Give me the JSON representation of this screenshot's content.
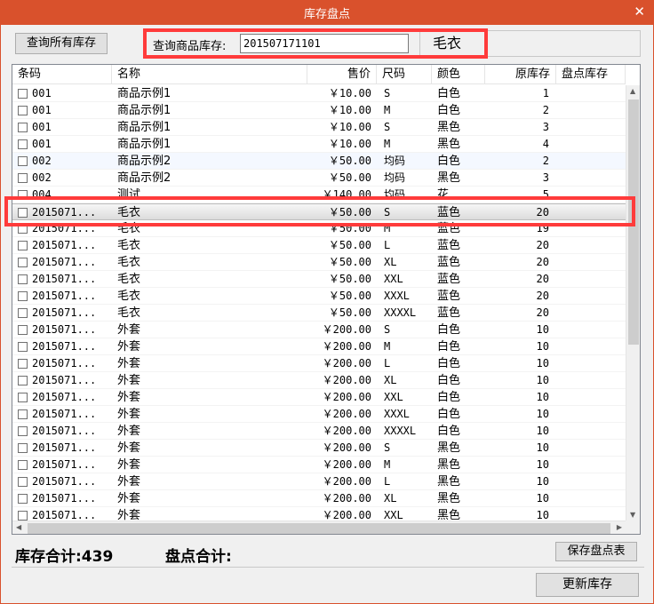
{
  "window": {
    "title": "库存盘点",
    "close_glyph": "✕"
  },
  "toolbar": {
    "query_all_label": "查询所有库存",
    "search_label": "查询商品库存:",
    "search_value": "201507171101",
    "search_result_name": "毛衣"
  },
  "table": {
    "headers": [
      "条码",
      "名称",
      "售价",
      "尺码",
      "颜色",
      "原库存",
      "盘点库存"
    ],
    "rows": [
      [
        "001",
        "商品示例1",
        "￥10.00",
        "S",
        "白色",
        "1",
        ""
      ],
      [
        "001",
        "商品示例1",
        "￥10.00",
        "M",
        "白色",
        "2",
        ""
      ],
      [
        "001",
        "商品示例1",
        "￥10.00",
        "S",
        "黑色",
        "3",
        ""
      ],
      [
        "001",
        "商品示例1",
        "￥10.00",
        "M",
        "黑色",
        "4",
        ""
      ],
      [
        "002",
        "商品示例2",
        "￥50.00",
        "均码",
        "白色",
        "2",
        ""
      ],
      [
        "002",
        "商品示例2",
        "￥50.00",
        "均码",
        "黑色",
        "3",
        ""
      ],
      [
        "004",
        "测试",
        "￥140.00",
        "均码",
        "花",
        "5",
        ""
      ],
      [
        "2015071...",
        "毛衣",
        "￥50.00",
        "S",
        "蓝色",
        "20",
        ""
      ],
      [
        "2015071...",
        "毛衣",
        "￥50.00",
        "M",
        "蓝色",
        "19",
        ""
      ],
      [
        "2015071...",
        "毛衣",
        "￥50.00",
        "L",
        "蓝色",
        "20",
        ""
      ],
      [
        "2015071...",
        "毛衣",
        "￥50.00",
        "XL",
        "蓝色",
        "20",
        ""
      ],
      [
        "2015071...",
        "毛衣",
        "￥50.00",
        "XXL",
        "蓝色",
        "20",
        ""
      ],
      [
        "2015071...",
        "毛衣",
        "￥50.00",
        "XXXL",
        "蓝色",
        "20",
        ""
      ],
      [
        "2015071...",
        "毛衣",
        "￥50.00",
        "XXXXL",
        "蓝色",
        "20",
        ""
      ],
      [
        "2015071...",
        "外套",
        "￥200.00",
        "S",
        "白色",
        "10",
        ""
      ],
      [
        "2015071...",
        "外套",
        "￥200.00",
        "M",
        "白色",
        "10",
        ""
      ],
      [
        "2015071...",
        "外套",
        "￥200.00",
        "L",
        "白色",
        "10",
        ""
      ],
      [
        "2015071...",
        "外套",
        "￥200.00",
        "XL",
        "白色",
        "10",
        ""
      ],
      [
        "2015071...",
        "外套",
        "￥200.00",
        "XXL",
        "白色",
        "10",
        ""
      ],
      [
        "2015071...",
        "外套",
        "￥200.00",
        "XXXL",
        "白色",
        "10",
        ""
      ],
      [
        "2015071...",
        "外套",
        "￥200.00",
        "XXXXL",
        "白色",
        "10",
        ""
      ],
      [
        "2015071...",
        "外套",
        "￥200.00",
        "S",
        "黑色",
        "10",
        ""
      ],
      [
        "2015071...",
        "外套",
        "￥200.00",
        "M",
        "黑色",
        "10",
        ""
      ],
      [
        "2015071...",
        "外套",
        "￥200.00",
        "L",
        "黑色",
        "10",
        ""
      ],
      [
        "2015071...",
        "外套",
        "￥200.00",
        "XL",
        "黑色",
        "10",
        ""
      ],
      [
        "2015071...",
        "外套",
        "￥200.00",
        "XXL",
        "黑色",
        "10",
        ""
      ]
    ],
    "selected_row": 7,
    "focus_row": 4
  },
  "footer": {
    "stock_total": "库存合计:439",
    "count_total": "盘点合计:",
    "save_label": "保存盘点表",
    "update_label": "更新库存"
  },
  "colors": {
    "titlebar": "#d9512c",
    "highlight": "#ff3b3b"
  },
  "icons": {
    "close": "close-icon",
    "scroll_up": "arrow-up-icon",
    "scroll_down": "arrow-down-icon",
    "scroll_left": "arrow-left-icon",
    "scroll_right": "arrow-right-icon"
  }
}
